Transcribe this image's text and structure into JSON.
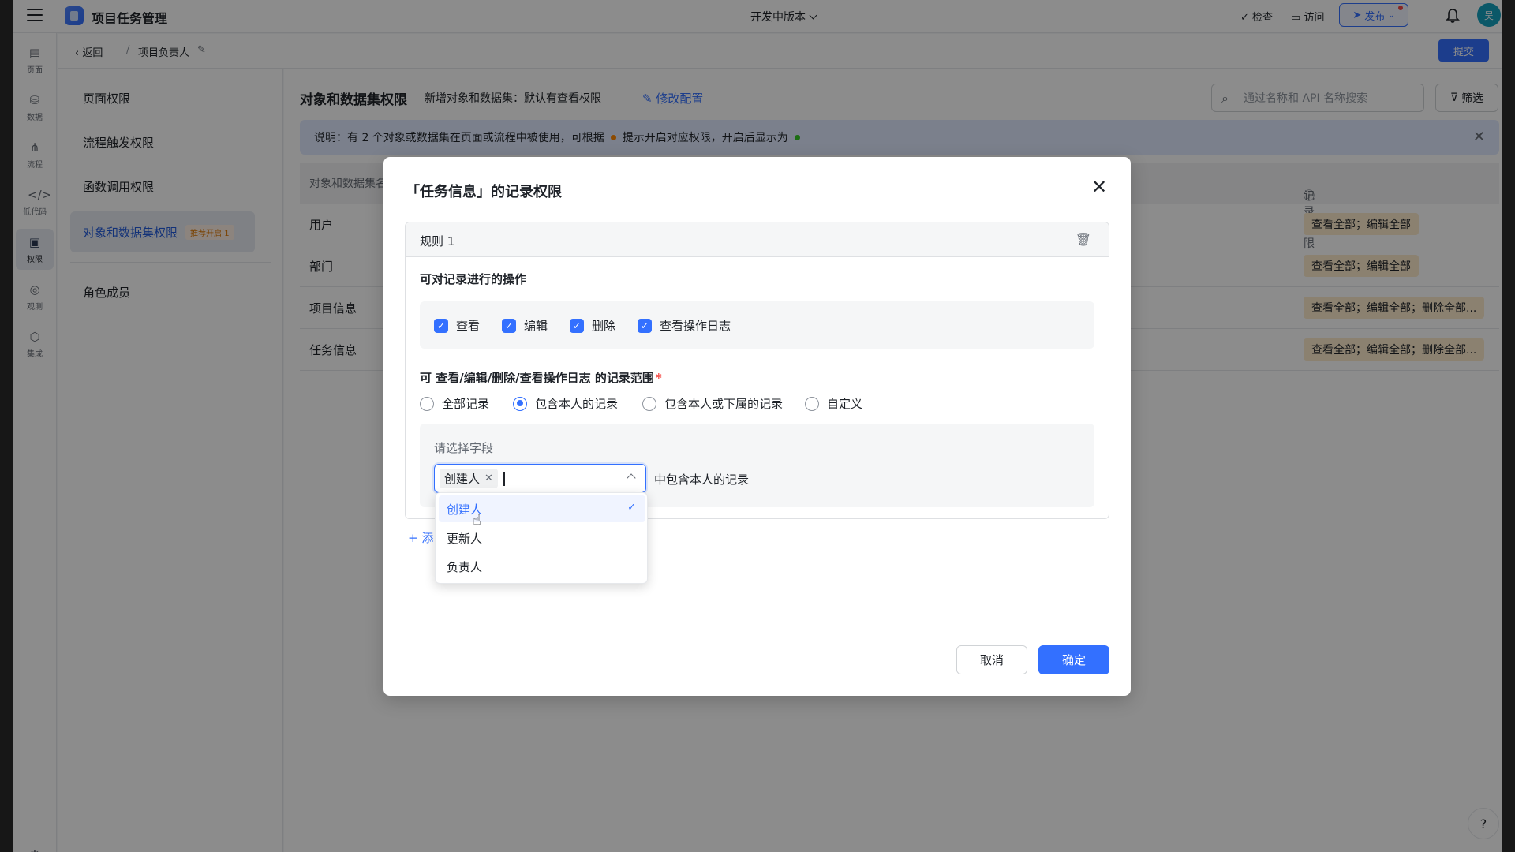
{
  "app": {
    "title": "项目任务管理",
    "version": "开发中版本"
  },
  "topbar": {
    "check_label": "检查",
    "visit_label": "访问",
    "publish_label": "发布",
    "avatar_text": "吴"
  },
  "rail": [
    {
      "label": "页面",
      "icon": "page-icon"
    },
    {
      "label": "数据",
      "icon": "database-icon"
    },
    {
      "label": "流程",
      "icon": "flow-icon"
    },
    {
      "label": "低代码",
      "icon": "code-icon"
    },
    {
      "label": "权限",
      "icon": "lock-icon"
    },
    {
      "label": "观测",
      "icon": "observe-icon"
    },
    {
      "label": "集成",
      "icon": "integration-icon"
    }
  ],
  "subbar": {
    "back_label": "返回",
    "sep": "/",
    "crumb": "项目负责人",
    "submit_label": "提交"
  },
  "subnav": {
    "items": [
      "页面权限",
      "流程触发权限",
      "函数调用权限",
      "对象和数据集权限",
      "角色成员"
    ],
    "badge": "推荐开启 1"
  },
  "main": {
    "title": "对象和数据集权限",
    "subtitle": "新增对象和数据集：默认有查看权限",
    "modify_label": "修改配置",
    "search_placeholder": "通过名称和 API 名称搜索",
    "filter_label": "筛选",
    "notice_a": "说明：有 2 个对象或数据集在页面或流程中被使用，可根据",
    "notice_b": "提示开启对应权限，开启后显示为",
    "col_name": "对象和数据集名",
    "col_record": "记录权限",
    "rows": [
      {
        "name": "用户",
        "perm": "查看全部；编辑全部"
      },
      {
        "name": "部门",
        "perm": "查看全部；编辑全部"
      },
      {
        "name": "项目信息",
        "perm": "查看全部；编辑全部；删除全部..."
      },
      {
        "name": "任务信息",
        "perm": "查看全部；编辑全部；删除全部..."
      }
    ]
  },
  "modal": {
    "title": "「任务信息」的记录权限",
    "rule_name": "规则 1",
    "ops_label": "可对记录进行的操作",
    "ops": [
      "查看",
      "编辑",
      "删除",
      "查看操作日志"
    ],
    "scope_label": "可 查看/编辑/删除/查看操作日志 的记录范围",
    "scope_required": "*",
    "scopes": [
      "全部记录",
      "包含本人的记录",
      "包含本人或下属的记录",
      "自定义"
    ],
    "scope_selected": "包含本人的记录",
    "field_label": "请选择字段",
    "selected_chip": "创建人",
    "after_select": "中包含本人的记录",
    "add_rule_label": "添",
    "options": [
      "创建人",
      "更新人",
      "负责人"
    ],
    "cancel_label": "取消",
    "ok_label": "确定"
  },
  "colors": {
    "accent": "#3370ff",
    "badge_bg": "#fff1e6",
    "tag_bg": "#fdeccd",
    "notice_bg": "#e1eaff"
  }
}
